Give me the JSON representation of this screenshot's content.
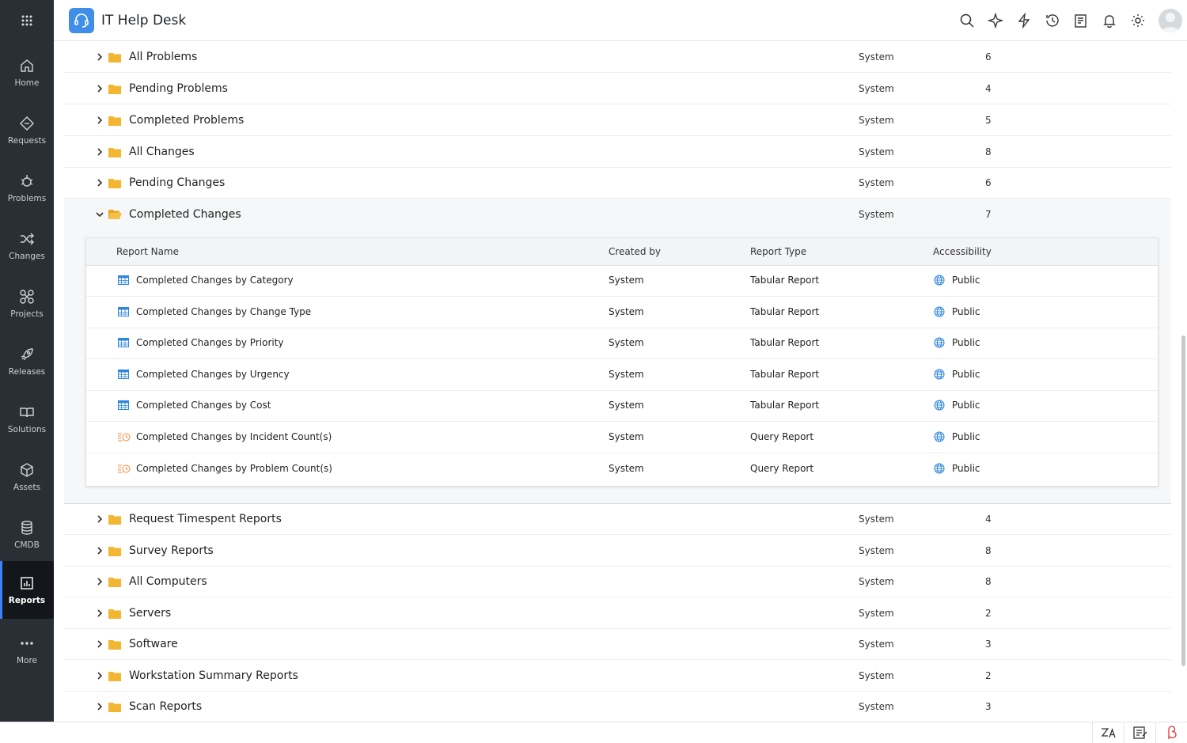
{
  "app": {
    "title": "IT Help Desk"
  },
  "nav": [
    {
      "label": "Home",
      "icon": "home-icon"
    },
    {
      "label": "Requests",
      "icon": "ticket-icon"
    },
    {
      "label": "Problems",
      "icon": "bug-icon"
    },
    {
      "label": "Changes",
      "icon": "shuffle-icon"
    },
    {
      "label": "Projects",
      "icon": "projects-icon"
    },
    {
      "label": "Releases",
      "icon": "rocket-icon"
    },
    {
      "label": "Solutions",
      "icon": "book-icon"
    },
    {
      "label": "Assets",
      "icon": "box-icon"
    },
    {
      "label": "CMDB",
      "icon": "database-icon"
    },
    {
      "label": "Reports",
      "icon": "reports-icon",
      "active": true
    },
    {
      "label": "More",
      "icon": "more-dots-icon"
    }
  ],
  "header_icons": [
    "search-icon",
    "magic-icon",
    "lightning-icon",
    "history-icon",
    "notes-icon",
    "bell-icon",
    "gear-icon"
  ],
  "folders_top": [
    {
      "name": "All Problems",
      "created_by": "System",
      "count": "6"
    },
    {
      "name": "Pending Problems",
      "created_by": "System",
      "count": "4"
    },
    {
      "name": "Completed Problems",
      "created_by": "System",
      "count": "5"
    },
    {
      "name": "All Changes",
      "created_by": "System",
      "count": "8"
    },
    {
      "name": "Pending Changes",
      "created_by": "System",
      "count": "6"
    }
  ],
  "expanded_folder": {
    "name": "Completed Changes",
    "created_by": "System",
    "count": "7",
    "columns": [
      "Report Name",
      "Created by",
      "Report Type",
      "Accessibility"
    ],
    "reports": [
      {
        "name": "Completed Changes by Category",
        "created_by": "System",
        "type": "Tabular Report",
        "access": "Public",
        "icon": "tabular-report-icon"
      },
      {
        "name": "Completed Changes by Change Type",
        "created_by": "System",
        "type": "Tabular Report",
        "access": "Public",
        "icon": "tabular-report-icon"
      },
      {
        "name": "Completed Changes by Priority",
        "created_by": "System",
        "type": "Tabular Report",
        "access": "Public",
        "icon": "tabular-report-icon"
      },
      {
        "name": "Completed Changes by Urgency",
        "created_by": "System",
        "type": "Tabular Report",
        "access": "Public",
        "icon": "tabular-report-icon"
      },
      {
        "name": "Completed Changes by Cost",
        "created_by": "System",
        "type": "Tabular Report",
        "access": "Public",
        "icon": "tabular-report-icon"
      },
      {
        "name": "Completed Changes by Incident Count(s)",
        "created_by": "System",
        "type": "Query Report",
        "access": "Public",
        "icon": "query-report-icon"
      },
      {
        "name": "Completed Changes by Problem Count(s)",
        "created_by": "System",
        "type": "Query Report",
        "access": "Public",
        "icon": "query-report-icon"
      }
    ]
  },
  "folders_bottom": [
    {
      "name": "Request Timespent Reports",
      "created_by": "System",
      "count": "4"
    },
    {
      "name": "Survey Reports",
      "created_by": "System",
      "count": "8"
    },
    {
      "name": "All Computers",
      "created_by": "System",
      "count": "8"
    },
    {
      "name": "Servers",
      "created_by": "System",
      "count": "2"
    },
    {
      "name": "Software",
      "created_by": "System",
      "count": "3"
    },
    {
      "name": "Workstation Summary Reports",
      "created_by": "System",
      "count": "2"
    },
    {
      "name": "Scan Reports",
      "created_by": "System",
      "count": "3"
    }
  ],
  "footer_icons": [
    "translate-icon",
    "notes-icon",
    "beta-icon"
  ],
  "colors": {
    "sidebar": "#2a2f35",
    "sidebar_active": "#13171b",
    "accent": "#3b82f6",
    "folder": "#f2b630",
    "logo": "#3f8ee8"
  }
}
